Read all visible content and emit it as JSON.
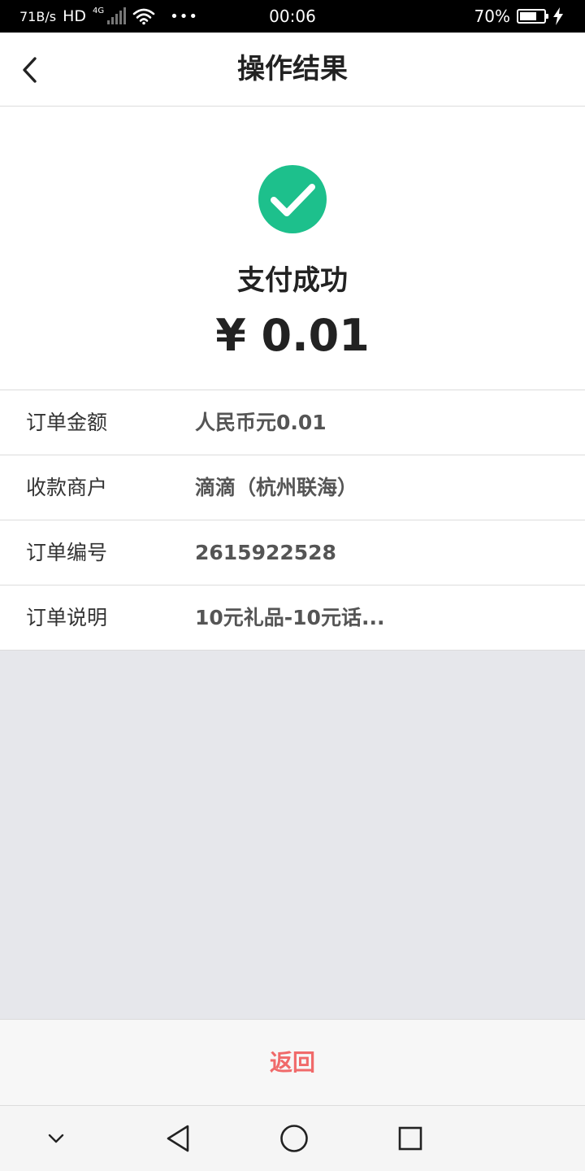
{
  "status_bar": {
    "speed": "71B/s",
    "hd": "HD",
    "network": "4G",
    "dots": "•••",
    "time": "00:06",
    "battery": "70%",
    "battery_level": 0.7
  },
  "header": {
    "title": "操作结果",
    "back_icon": "chevron-left-icon"
  },
  "result": {
    "status_icon": "check-circle-icon",
    "status_color": "#1dc08c",
    "title": "支付成功",
    "amount": "¥ 0.01"
  },
  "details": [
    {
      "label": "订单金额",
      "value": "人民币元0.01"
    },
    {
      "label": "收款商户",
      "value": "滴滴（杭州联海）"
    },
    {
      "label": "订单编号",
      "value": "2615922528"
    },
    {
      "label": "订单说明",
      "value": "10元礼品-10元话..."
    }
  ],
  "footer": {
    "return_label": "返回",
    "return_color": "#f06a6a"
  },
  "nav_bar": {
    "items": [
      "chevron-down-icon",
      "back-triangle-icon",
      "home-circle-icon",
      "recents-square-icon"
    ]
  }
}
